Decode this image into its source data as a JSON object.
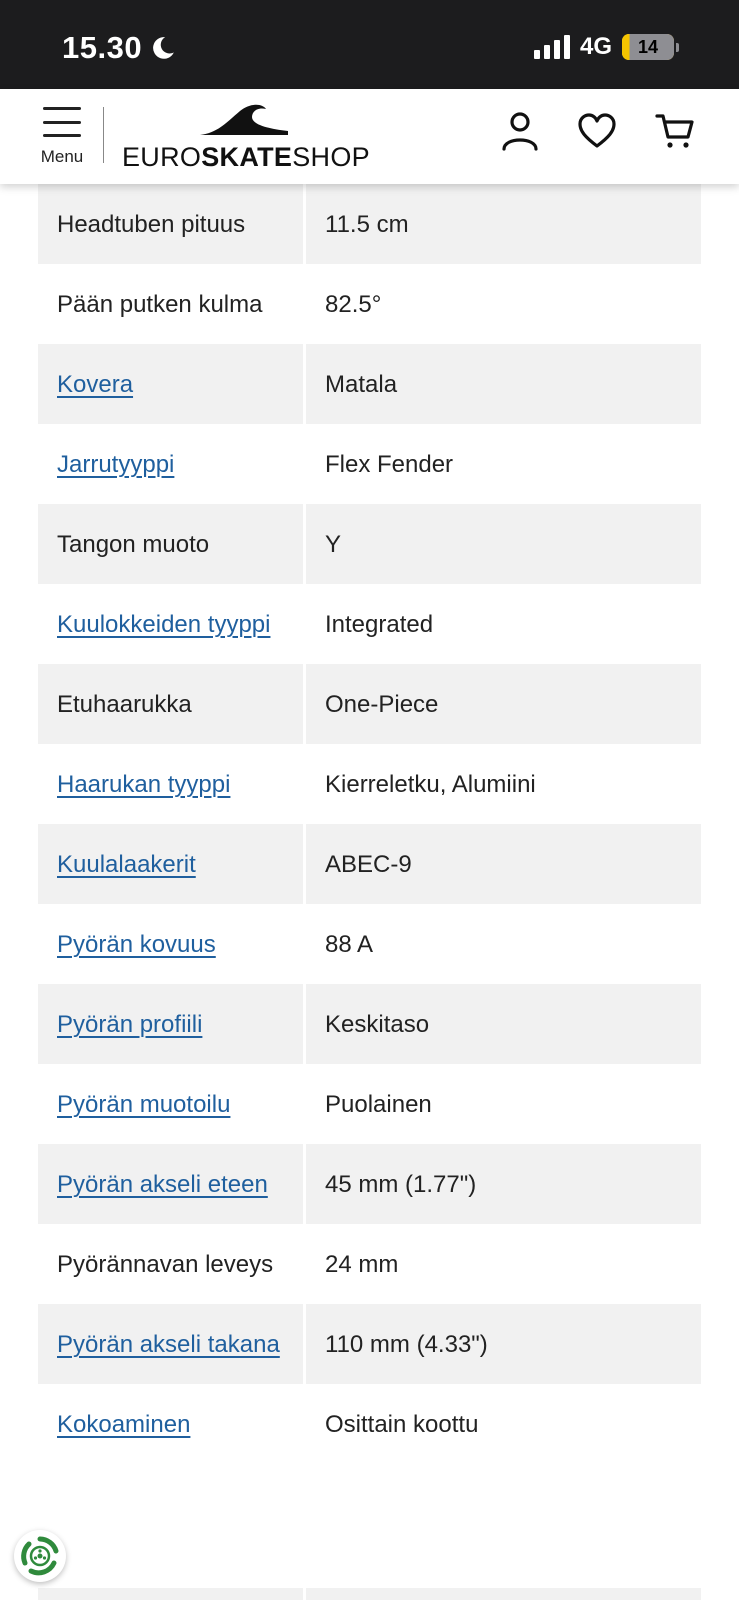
{
  "status": {
    "time": "15.30",
    "network": "4G",
    "battery": "14"
  },
  "header": {
    "menu_label": "Menu",
    "logo_text_1": "EURO",
    "logo_text_2": "SKATE",
    "logo_text_3": "SHOP"
  },
  "specs": [
    {
      "label": "Headtuben pituus",
      "value": "11.5 cm",
      "link": false
    },
    {
      "label": "Pään putken kulma",
      "value": "82.5°",
      "link": false
    },
    {
      "label": "Kovera",
      "value": "Matala",
      "link": true
    },
    {
      "label": "Jarrutyyppi",
      "value": "Flex Fender",
      "link": true
    },
    {
      "label": "Tangon muoto",
      "value": "Y",
      "link": false
    },
    {
      "label": "Kuulokkeiden tyyppi",
      "value": "Integrated",
      "link": true
    },
    {
      "label": "Etuhaarukka",
      "value": "One-Piece",
      "link": false
    },
    {
      "label": "Haarukan tyyppi",
      "value": "Kierreletku, Alumiini",
      "link": true
    },
    {
      "label": "Kuulalaakerit",
      "value": "ABEC-9",
      "link": true
    },
    {
      "label": "Pyörän kovuus",
      "value": "88 A",
      "link": true
    },
    {
      "label": "Pyörän profiili",
      "value": "Keskitaso",
      "link": true
    },
    {
      "label": "Pyörän muotoilu",
      "value": "Puolainen",
      "link": true
    },
    {
      "label": "Pyörän akseli eteen",
      "value": "45 mm (1.77\")",
      "link": true
    },
    {
      "label": "Pyörännavan leveys",
      "value": "24 mm",
      "link": false
    },
    {
      "label": "Pyörän akseli takana",
      "value": "110 mm (4.33\")",
      "link": true
    },
    {
      "label": "Kokoaminen",
      "value": "Osittain koottu",
      "link": true
    }
  ]
}
